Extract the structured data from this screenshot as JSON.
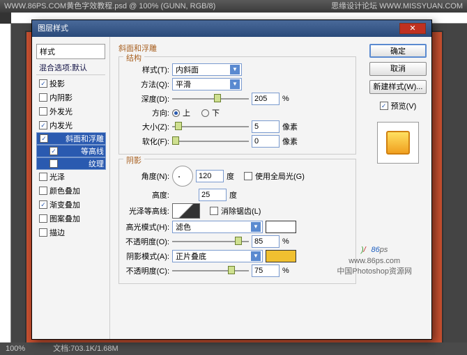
{
  "app": {
    "title_left": "WWW.86PS.COM黄色字效教程.psd @ 100% (GUNN, RGB/8)",
    "title_right": "思缘设计论坛  WWW.MISSYUAN.COM"
  },
  "status": {
    "zoom": "100%",
    "doc": "文档:703.1K/1.68M"
  },
  "dialog": {
    "title": "图层样式",
    "buttons": {
      "ok": "确定",
      "cancel": "取消",
      "newstyle": "新建样式(W)..."
    },
    "preview_label": "预览(V)"
  },
  "styles": {
    "header": "样式",
    "blend_header": "混合选项:默认",
    "items": [
      {
        "label": "投影",
        "checked": true
      },
      {
        "label": "内阴影",
        "checked": false
      },
      {
        "label": "外发光",
        "checked": false
      },
      {
        "label": "内发光",
        "checked": true
      },
      {
        "label": "斜面和浮雕",
        "checked": true,
        "selected": true
      },
      {
        "label": "等高线",
        "checked": true,
        "sub": true,
        "subsel": true
      },
      {
        "label": "纹理",
        "checked": false,
        "sub": true,
        "subsel": true
      },
      {
        "label": "光泽",
        "checked": false
      },
      {
        "label": "颜色叠加",
        "checked": false
      },
      {
        "label": "渐变叠加",
        "checked": true
      },
      {
        "label": "图案叠加",
        "checked": false
      },
      {
        "label": "描边",
        "checked": false
      }
    ]
  },
  "bevel": {
    "title": "斜面和浮雕",
    "structure": {
      "legend": "结构",
      "style_label": "样式(T):",
      "style_val": "内斜面",
      "method_label": "方法(Q):",
      "method_val": "平滑",
      "depth_label": "深度(D):",
      "depth_val": "205",
      "pct": "%",
      "dir_label": "方向:",
      "up": "上",
      "down": "下",
      "size_label": "大小(Z):",
      "size_val": "5",
      "px": "像素",
      "soften_label": "软化(F):",
      "soften_val": "0"
    },
    "shading": {
      "legend": "阴影",
      "angle_label": "角度(N):",
      "angle_val": "120",
      "deg": "度",
      "global_label": "使用全局光(G)",
      "alt_label": "高度:",
      "alt_val": "25",
      "gloss_label": "光泽等高线:",
      "antialias_label": "消除锯齿(L)",
      "hl_mode_label": "高光模式(H):",
      "hl_mode_val": "滤色",
      "hl_op_label": "不透明度(O):",
      "hl_op_val": "85",
      "sh_mode_label": "阴影模式(A):",
      "sh_mode_val": "正片叠底",
      "sh_op_label": "不透明度(C):",
      "sh_op_val": "75"
    }
  },
  "watermark": {
    "brand": "86",
    "suffix": "ps",
    "url": "www.86ps.com",
    "tag": "中国Photoshop资源网"
  }
}
